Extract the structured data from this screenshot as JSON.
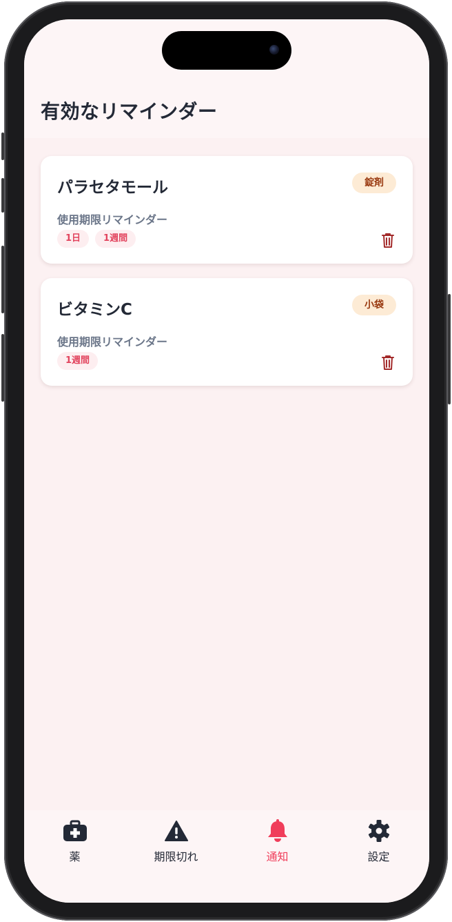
{
  "header": {
    "title": "有効なリマインダー"
  },
  "reminders": [
    {
      "name": "パラセタモール",
      "type": "錠剤",
      "label": "使用期限リマインダー",
      "chips": [
        "1日",
        "1週間"
      ]
    },
    {
      "name": "ビタミンC",
      "type": "小袋",
      "label": "使用期限リマインダー",
      "chips": [
        "1週間"
      ]
    }
  ],
  "tabs": [
    {
      "label": "薬",
      "icon": "medical-kit-icon",
      "active": false
    },
    {
      "label": "期限切れ",
      "icon": "warning-icon",
      "active": false
    },
    {
      "label": "通知",
      "icon": "bell-icon",
      "active": true
    },
    {
      "label": "設定",
      "icon": "gear-icon",
      "active": false
    }
  ],
  "colors": {
    "accent": "#f03d5a",
    "background": "#fcf1f2",
    "title_text": "#232936",
    "badge_bg": "#fdebd5",
    "badge_text": "#9a3b12",
    "chip_bg": "#fdeef0",
    "chip_text": "#e2445e",
    "trash_icon": "#a32a2a"
  }
}
